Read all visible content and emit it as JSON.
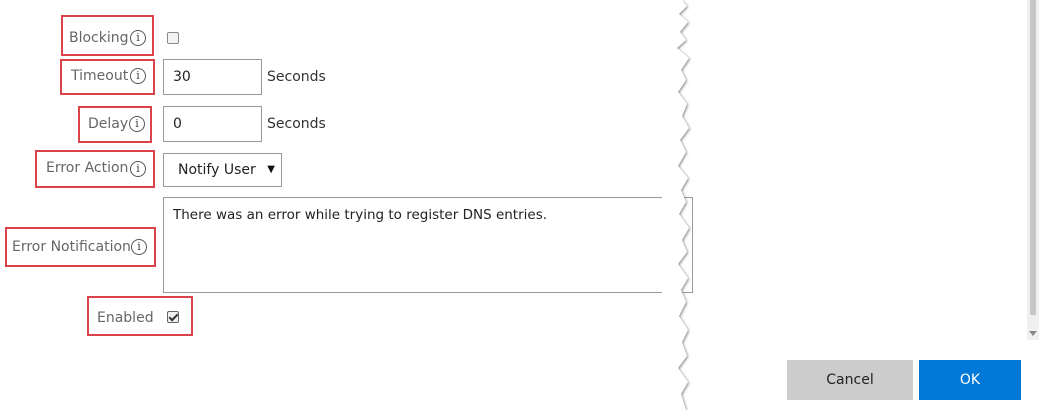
{
  "form": {
    "blocking": {
      "label": "Blocking",
      "checked": false
    },
    "timeout": {
      "label": "Timeout",
      "value": "30",
      "unit": "Seconds"
    },
    "delay": {
      "label": "Delay",
      "value": "0",
      "unit": "Seconds"
    },
    "error_action": {
      "label": "Error Action",
      "selected": "Notify User"
    },
    "error_notification": {
      "label": "Error Notification",
      "value": "There was an error while trying to register DNS entries."
    },
    "enabled": {
      "label": "Enabled",
      "checked": true
    }
  },
  "info_glyph": "i",
  "buttons": {
    "cancel": "Cancel",
    "ok": "OK"
  },
  "colors": {
    "highlight": "#d9434a",
    "primary": "#0078d7",
    "secondary": "#cccccc"
  }
}
